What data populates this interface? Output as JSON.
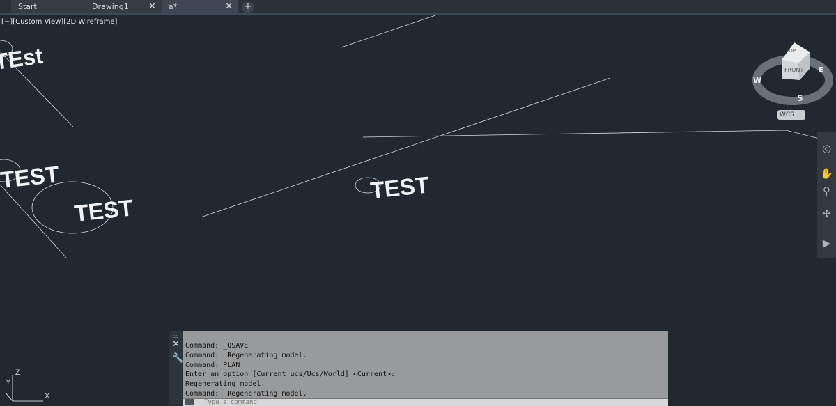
{
  "tabs": [
    {
      "label": "Start",
      "closable": false
    },
    {
      "label": "Drawing1",
      "closable": true
    },
    {
      "label": "a*",
      "closable": true,
      "active": true
    }
  ],
  "tab_close_symbol": "✕",
  "tab_add_symbol": "+",
  "view_label": "[−][Custom View][2D Wireframe]",
  "drawing": {
    "texts": [
      "TEst",
      "TEST",
      "TEST",
      "TEST"
    ],
    "line_color": "#d8dce0"
  },
  "viewcube": {
    "top": "TOP",
    "front": "FRONT",
    "compass": {
      "w": "W",
      "e": "E",
      "s": "S"
    },
    "wcs": "WCS"
  },
  "navbar_icons": [
    "steering-wheel-icon",
    "pan-icon",
    "zoom-icon",
    "orbit-icon",
    "showmotion-icon"
  ],
  "command": {
    "history": [
      "Command: _QSAVE",
      "Command:  Regenerating model.",
      "Command: PLAN",
      "Enter an option [Current ucs/Ucs/World] <Current>:",
      "Regenerating model.",
      "Command:  Regenerating model."
    ],
    "placeholder": "Type a command"
  },
  "ucs": {
    "z": "Z",
    "y": "Y",
    "x": "X"
  },
  "colors": {
    "background": "#212830",
    "command_bg": "#999a9c"
  }
}
